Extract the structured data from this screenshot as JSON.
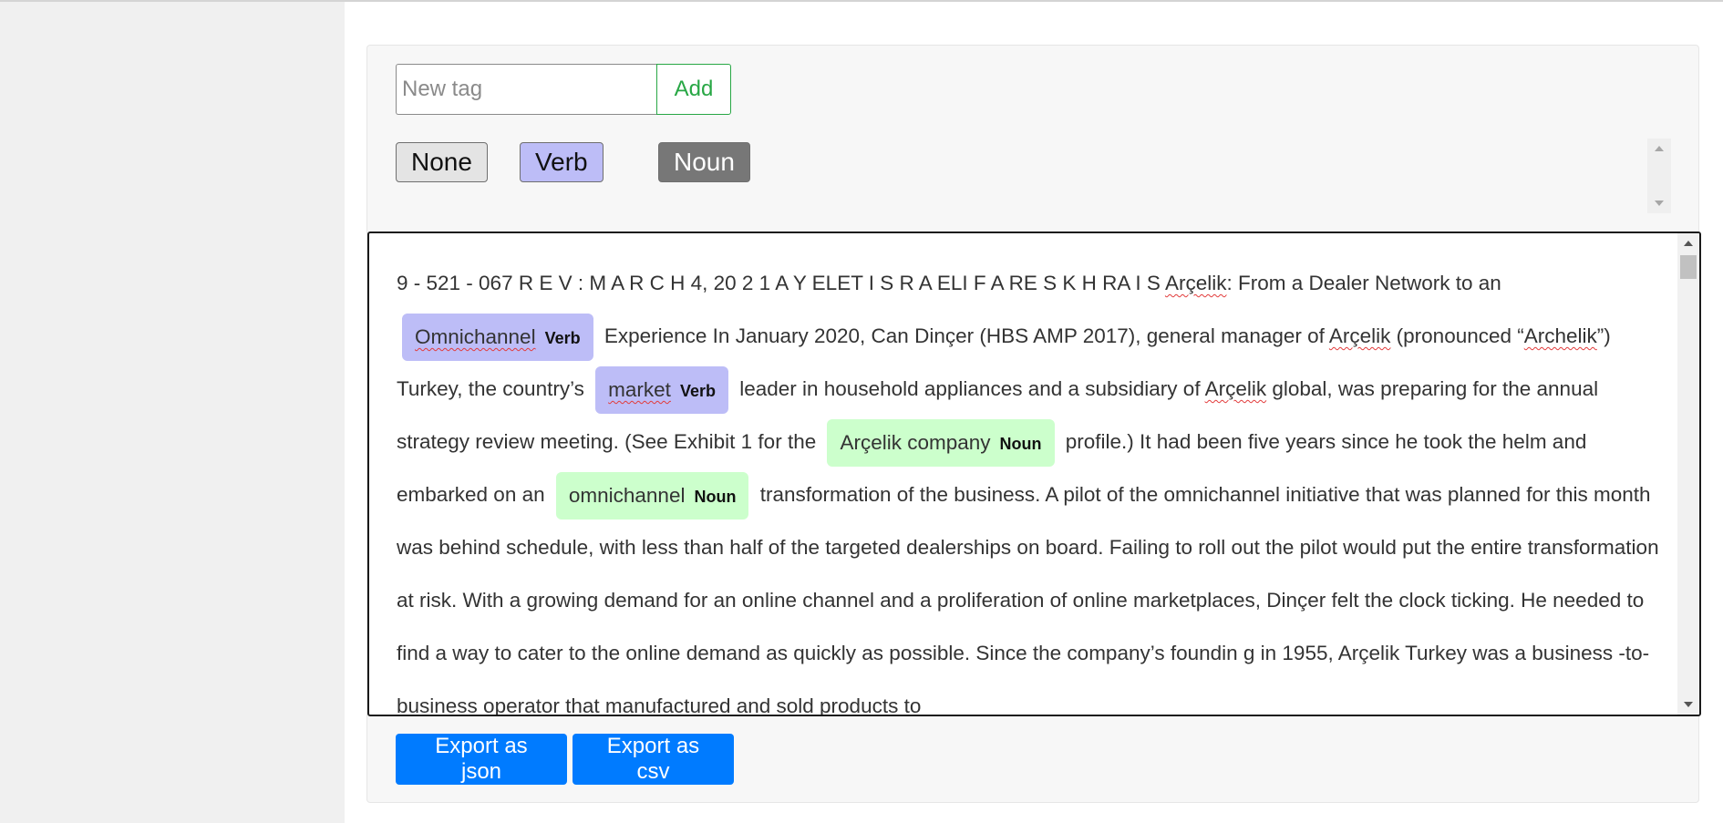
{
  "tag_input": {
    "placeholder": "New tag",
    "value": "",
    "add_label": "Add"
  },
  "tags": [
    {
      "label": "None",
      "color": "#e4e4e4"
    },
    {
      "label": "Verb",
      "color": "#bdbdf7"
    },
    {
      "label": "Noun",
      "color": "#777777"
    }
  ],
  "document": {
    "p1": "9 - 521 - 067 R E V : M A R C H 4, 20 2 1 A Y ELET I S R A ELI F A RE S K H RA I S ",
    "w1": "Arçelik",
    "p2": ": From a Dealer Network to an ",
    "e1_text": "Omnichannel",
    "e1_label": "Verb",
    "p3": " Experience In January 2020, Can Dinçer (HBS AMP 2017), general manager of ",
    "w2": "Arçelik",
    "p4": " (pronounced “",
    "w3": "Archelik",
    "p5": "”) Turkey, the country’s ",
    "e2_text": "market",
    "e2_label": "Verb",
    "p6": " leader in household appliances and a subsidiary of ",
    "w4": "Arçelik",
    "p7": " global, was preparing for the annual strategy review meeting. (See Exhibit 1 for the ",
    "e3_text": "Arçelik company",
    "e3_label": "Noun",
    "p8": " profile.) It had been five years since he took the helm and embarked on an ",
    "e4_text": "omnichannel",
    "e4_label": "Noun",
    "p9": " transformation of the business. A pilot of the omnichannel initiative that was planned for this month was behind schedule, with less than half of the targeted dealerships on board. Failing to roll out the pilot would put the entire transformation at risk. With a growing demand for an online channel and a proliferation of online marketplaces, Dinçer felt the clock ticking. He needed to find a way to cater to the online demand as quickly as possible. Since the company’s foundin g in 1955, Arçelik Turkey was a business -to-business operator that manufactured and sold products to"
  },
  "export": {
    "json_label": "Export as json",
    "csv_label": "Export as csv"
  },
  "colors": {
    "verb": "#bdbdf7",
    "noun": "#ccffcc",
    "primary": "#007bff",
    "success": "#28a745"
  }
}
